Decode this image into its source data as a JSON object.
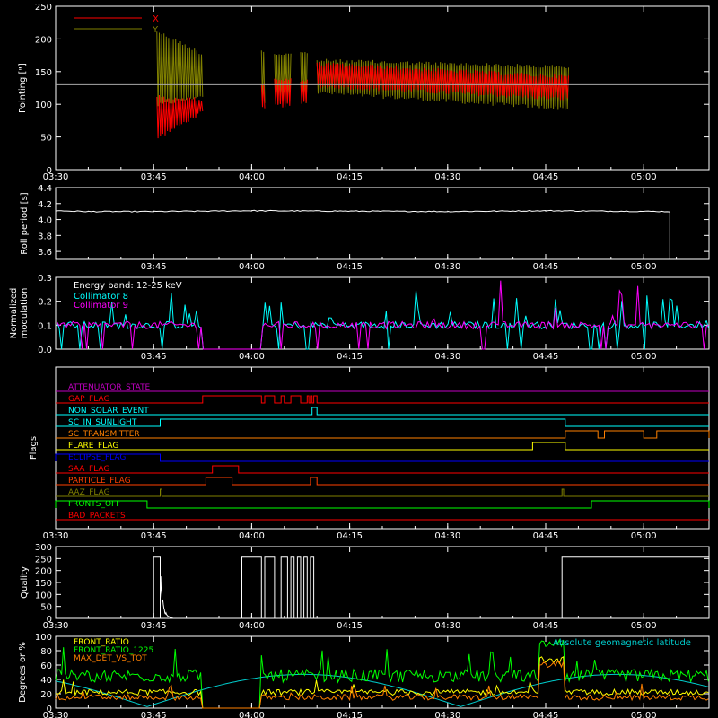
{
  "chart_data": [
    {
      "type": "line",
      "panel": "pointing",
      "ylabel": "Pointing [\"]",
      "ylim": [
        0,
        250
      ],
      "yticks": [
        0,
        50,
        100,
        150,
        200,
        250
      ],
      "xticks": [
        "03:30",
        "03:45",
        "04:00",
        "04:15",
        "04:30",
        "04:45",
        "05:00"
      ],
      "xtick_labels_shown": true,
      "legend_placement": "top-left",
      "series": [
        {
          "name": "X",
          "color": "#ff0000",
          "segments": [
            {
              "x_start": "03:45:30",
              "x_end": "03:52:30",
              "y_low": [
                45,
                85
              ],
              "y_high": [
                115,
                110
              ]
            },
            {
              "x_start": "04:01:30",
              "x_end": "04:02:00",
              "y_low": [
                90,
                90
              ],
              "y_high": [
                135,
                135
              ]
            },
            {
              "x_start": "04:03:30",
              "x_end": "04:06:00",
              "y_low": [
                95,
                95
              ],
              "y_high": [
                140,
                140
              ]
            },
            {
              "x_start": "04:07:30",
              "x_end": "04:08:30",
              "y_low": [
                98,
                98
              ],
              "y_high": [
                140,
                140
              ]
            },
            {
              "x_start": "04:10:00",
              "x_end": "04:48:30",
              "y_low": [
                125,
                105
              ],
              "y_high": [
                165,
                145
              ]
            }
          ]
        },
        {
          "name": "Y",
          "color": "#808000",
          "segments": [
            {
              "x_start": "03:45:30",
              "x_end": "03:52:30",
              "y_low": [
                95,
                110
              ],
              "y_high": [
                215,
                180
              ]
            },
            {
              "x_start": "04:01:30",
              "x_end": "04:02:00",
              "y_low": [
                100,
                100
              ],
              "y_high": [
                185,
                185
              ]
            },
            {
              "x_start": "04:03:30",
              "x_end": "04:06:00",
              "y_low": [
                100,
                100
              ],
              "y_high": [
                180,
                180
              ]
            },
            {
              "x_start": "04:07:30",
              "x_end": "04:08:30",
              "y_low": [
                100,
                100
              ],
              "y_high": [
                180,
                180
              ]
            },
            {
              "x_start": "04:10:00",
              "x_end": "04:48:30",
              "y_low": [
                115,
                90
              ],
              "y_high": [
                170,
                160
              ]
            }
          ]
        }
      ],
      "reference_line": {
        "y": 130,
        "color": "#aaaaaa"
      }
    },
    {
      "type": "line",
      "panel": "roll_period",
      "ylabel": "Roll period [s]",
      "ylim": [
        3.5,
        4.4
      ],
      "yticks": [
        3.6,
        3.8,
        4.0,
        4.2,
        4.4
      ],
      "xticks": [
        "03:45",
        "04:00",
        "04:15",
        "04:30",
        "04:45",
        "05:00"
      ],
      "series": [
        {
          "name": "",
          "color": "#ffffff",
          "points": [
            [
              "03:30",
              4.11
            ],
            [
              "03:35",
              4.1
            ],
            [
              "03:45",
              4.1
            ],
            [
              "04:00",
              4.11
            ],
            [
              "04:30",
              4.1
            ],
            [
              "04:45",
              4.11
            ],
            [
              "05:04",
              4.1
            ],
            [
              "05:04",
              3.5
            ]
          ]
        }
      ]
    },
    {
      "type": "line",
      "panel": "modulation",
      "ylabel_lines": [
        "Normalized",
        "modulation"
      ],
      "ylim": [
        0,
        0.3
      ],
      "yticks": [
        0.0,
        0.1,
        0.2,
        0.3
      ],
      "xticks": [
        "03:45",
        "04:00",
        "04:15",
        "04:30",
        "04:45",
        "05:00"
      ],
      "annotation": "Energy band: 12-25 keV",
      "legend_placement": "top-left",
      "series": [
        {
          "name": "Collimator 8",
          "color": "#00ffff",
          "baseline": 0.1,
          "noise": 0.06
        },
        {
          "name": "Collimator 9",
          "color": "#ff00ff",
          "baseline": 0.1,
          "noise": 0.08
        }
      ]
    },
    {
      "type": "line",
      "panel": "flags",
      "ylabel": "Flags",
      "xticks": [
        "03:30",
        "03:45",
        "04:00",
        "04:15",
        "04:30",
        "04:45",
        "05:00"
      ],
      "flags": [
        {
          "name": "ATTENUATOR_STATE",
          "color": "#c000c0",
          "on": []
        },
        {
          "name": "GAP_FLAG",
          "color": "#ff0000",
          "on": [
            [
              "03:52:30",
              "04:01:30"
            ],
            [
              "04:02:00",
              "04:03:30"
            ],
            [
              "04:04:30",
              "04:05:00"
            ],
            [
              "04:06:00",
              "04:07:30"
            ],
            [
              "04:08:30",
              "04:08:45"
            ],
            [
              "04:09:00",
              "04:09:15"
            ],
            [
              "04:09:30",
              "04:10:00"
            ]
          ]
        },
        {
          "name": "NON_SOLAR_EVENT",
          "color": "#00ffff",
          "on": [
            [
              "04:09:15",
              "04:10:00"
            ]
          ]
        },
        {
          "name": "SC_IN_SUNLIGHT",
          "color": "#00ffff",
          "on": [
            [
              "03:46:00",
              "04:48:00"
            ]
          ]
        },
        {
          "name": "SC_TRANSMITTER",
          "color": "#ff8000",
          "on": [
            [
              "04:48:00",
              "04:53:00"
            ],
            [
              "04:54:00",
              "05:00:00"
            ],
            [
              "05:02:00",
              "05:10:00"
            ]
          ]
        },
        {
          "name": "FLARE_FLAG",
          "color": "#ffff00",
          "on": [
            [
              "04:43:00",
              "04:48:00"
            ]
          ]
        },
        {
          "name": "ECLIPSE_FLAG",
          "color": "#0000ff",
          "on": [
            [
              "03:30:00",
              "03:46:00"
            ]
          ]
        },
        {
          "name": "SAA_FLAG",
          "color": "#ff0000",
          "on": [
            [
              "03:54:00",
              "03:58:00"
            ]
          ]
        },
        {
          "name": "PARTICLE_FLAG",
          "color": "#ff4000",
          "on": [
            [
              "03:53:00",
              "03:57:00"
            ],
            [
              "04:09:00",
              "04:10:00"
            ]
          ]
        },
        {
          "name": "AAZ_FLAG",
          "color": "#808000",
          "on": [
            [
              "03:46:00",
              "03:46:15"
            ],
            [
              "04:47:30",
              "04:47:45"
            ]
          ]
        },
        {
          "name": "FRONTS_OFF",
          "color": "#00ff00",
          "on": [
            [
              "03:30:00",
              "03:44:00"
            ],
            [
              "04:52:00",
              "05:10:00"
            ]
          ]
        },
        {
          "name": "BAD_PACKETS",
          "color": "#ff0000",
          "on": []
        }
      ]
    },
    {
      "type": "line",
      "panel": "quality",
      "ylabel": "Quality",
      "ylim": [
        0,
        300
      ],
      "yticks": [
        0,
        50,
        100,
        150,
        200,
        250,
        300
      ],
      "xticks": [
        "03:30",
        "03:45",
        "04:00",
        "04:15",
        "04:30",
        "04:45",
        "05:00"
      ],
      "series": [
        {
          "name": "",
          "color": "#ffffff",
          "on_value": 256,
          "on_intervals": [
            [
              "03:45:00",
              "03:46:00"
            ],
            [
              "03:58:30",
              "04:01:30"
            ],
            [
              "04:02:00",
              "04:03:30"
            ],
            [
              "04:04:30",
              "04:05:30"
            ],
            [
              "04:06:00",
              "04:06:30"
            ],
            [
              "04:07:00",
              "04:07:30"
            ],
            [
              "04:08:00",
              "04:08:30"
            ],
            [
              "04:09:00",
              "04:09:30"
            ],
            [
              "04:47:30",
              "05:10:00"
            ]
          ]
        }
      ]
    },
    {
      "type": "line",
      "panel": "ratios",
      "ylabel": "Degrees or %",
      "ylim": [
        0,
        100
      ],
      "yticks": [
        0,
        20,
        40,
        60,
        80,
        100
      ],
      "xticks": [
        "03:30",
        "03:45",
        "04:00",
        "04:15",
        "04:30",
        "04:45",
        "05:00"
      ],
      "legend_placement": "top-left",
      "series": [
        {
          "name": "FRONT_RATIO",
          "color": "#ffff00",
          "level": 22
        },
        {
          "name": "FRONT_RATIO_1225",
          "color": "#00ff00",
          "level": 45
        },
        {
          "name": "MAX_DET_VS_TOT",
          "color": "#ff8000",
          "level": 15
        },
        {
          "name": "Absolute geomagnetic latitude",
          "color": "#00cccc",
          "level": 30
        }
      ]
    }
  ]
}
